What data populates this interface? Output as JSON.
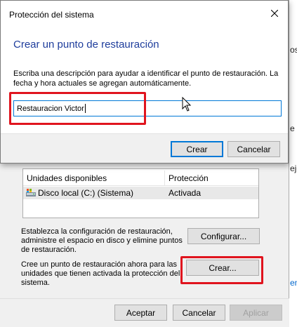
{
  "dialog": {
    "title": "Protección del sistema",
    "heading": "Crear un punto de restauración",
    "description": "Escriba una descripción para ayudar a identificar el punto de restauración. La fecha y hora actuales se agregan automáticamente.",
    "input_value": "Restauracion Victor",
    "create_label": "Crear",
    "cancel_label": "Cancelar"
  },
  "protection": {
    "columns": [
      "Unidades disponibles",
      "Protección"
    ],
    "rows": [
      {
        "drive": "Disco local (C:) (Sistema)",
        "status": "Activada"
      }
    ],
    "config_text": "Establezca la configuración de restauración, administre el espacio en disco y elimine puntos de restauración.",
    "config_button": "Configurar...",
    "create_text": "Cree un punto de restauración ahora para las unidades que tienen activada la protección del sistema.",
    "create_button": "Crear..."
  },
  "footer": {
    "accept_label": "Aceptar",
    "cancel_label": "Cancelar",
    "apply_label": "Aplicar"
  },
  "right_edge": {
    "text1": "os",
    "text2": "e 6",
    "text3": "ejo",
    "link": "enc"
  },
  "colors": {
    "heading": "#1e3d9c",
    "highlight": "#e0141e",
    "focus": "#0078d7"
  }
}
